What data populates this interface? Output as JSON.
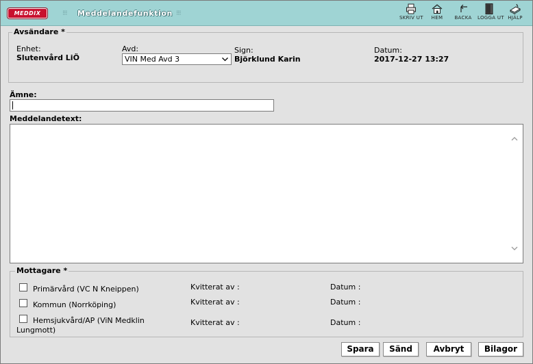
{
  "header": {
    "logo_text": "MEDDIX",
    "title": "Meddelandefunktion",
    "tools": [
      {
        "label": "SKRIV UT",
        "icon": "printer-icon"
      },
      {
        "label": "HEM",
        "icon": "home-icon"
      },
      {
        "label": "BACKA",
        "icon": "back-arrow-icon"
      },
      {
        "label": "LOGGA UT",
        "icon": "logout-door-icon"
      },
      {
        "label": "HJÄLP",
        "icon": "help-book-icon"
      }
    ]
  },
  "sender": {
    "legend": "Avsändare *",
    "unit_label": "Enhet:",
    "unit_value": "Slutenvård LiÖ",
    "dept_label": "Avd:",
    "dept_value": "VIN Med Avd 3",
    "sign_label": "Sign:",
    "sign_value": "Björklund Karin",
    "date_label": "Datum:",
    "date_value": "2017-12-27 13:27"
  },
  "message": {
    "subject_label": "Ämne:",
    "subject_value": "",
    "text_label": "Meddelandetext:",
    "text_value": ""
  },
  "recipients": {
    "legend": "Mottagare *",
    "items": [
      {
        "name": "Primärvård (VC N Kneippen)",
        "ack_label": "Kvitterat av :",
        "date_label": "Datum :"
      },
      {
        "name": "Kommun (Norrköping)",
        "ack_label": "Kvitterat av :",
        "date_label": "Datum :"
      },
      {
        "name_line1": "Hemsjukvård/AP (ViN Medklin",
        "name_line2": "Lungmott)",
        "ack_label": "Kvitterat av :",
        "date_label": "Datum :"
      }
    ]
  },
  "buttons": {
    "save": "Spara",
    "send": "Sänd",
    "cancel": "Avbryt",
    "attachments": "Bilagor"
  },
  "colors": {
    "header_bg": "#9fd4d4",
    "logo_red": "#c8102e",
    "panel_bg": "#e2e2e2"
  }
}
